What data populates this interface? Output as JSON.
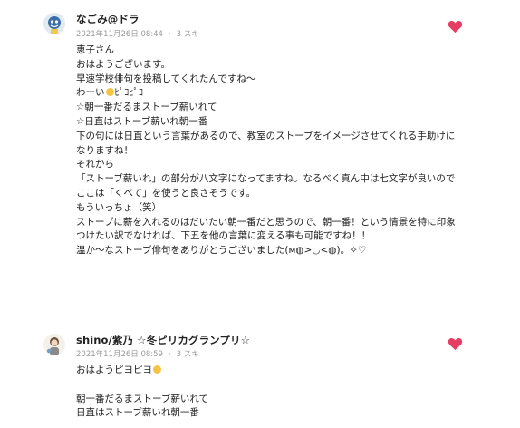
{
  "comments": [
    {
      "author": "なごみ@ドラ",
      "date": "2021年11月26日 08:44",
      "likes": "3 スキ",
      "lines": [
        "恵子さん",
        "おはようございます。",
        "早速学校俳句を投稿してくれたんですね〜",
        "わーい",
        "☆朝一番だるまストーブ薪いれて",
        "☆日直はストーブ薪いれ朝一番",
        "下の句には日直という言葉があるので、教室のストーブをイメージさせてくれる手助けに",
        "なりますね！",
        "それから",
        "「ストーブ薪いれ」の部分が八文字になってますね。なるべく真ん中は七文字が良いので",
        "ここは「くべて」を使うと良さそうです。",
        "もういっちょ（笑）",
        "ストーブに薪を入れるのはだいたい朝一番だと思うので、朝一番！という情景を特に印象",
        "つけたい訳でなければ、下五を他の言葉に変える事も可能ですね！！",
        "温か〜なストーブ俳句をありがとうございました(ᴍ◍>◡<◍)。✧♡"
      ],
      "inline_emoji": "ﾋﾟﾖﾋﾟﾖ"
    },
    {
      "author": "shino/紫乃 ☆冬ピリカグランプリ☆",
      "date": "2021年11月26日 08:59",
      "likes": "3 スキ",
      "lines": [
        "おはようピヨピヨ",
        "",
        "朝一番だるまストーブ薪いれて",
        "日直はストーブ薪いれ朝一番"
      ]
    }
  ],
  "colors": {
    "heart": "#e63e62",
    "meta": "#9a9a9a",
    "text": "#222222"
  },
  "icons": {
    "like": "heart-icon",
    "avatar1": "avatar-icon",
    "avatar2": "avatar-icon"
  }
}
